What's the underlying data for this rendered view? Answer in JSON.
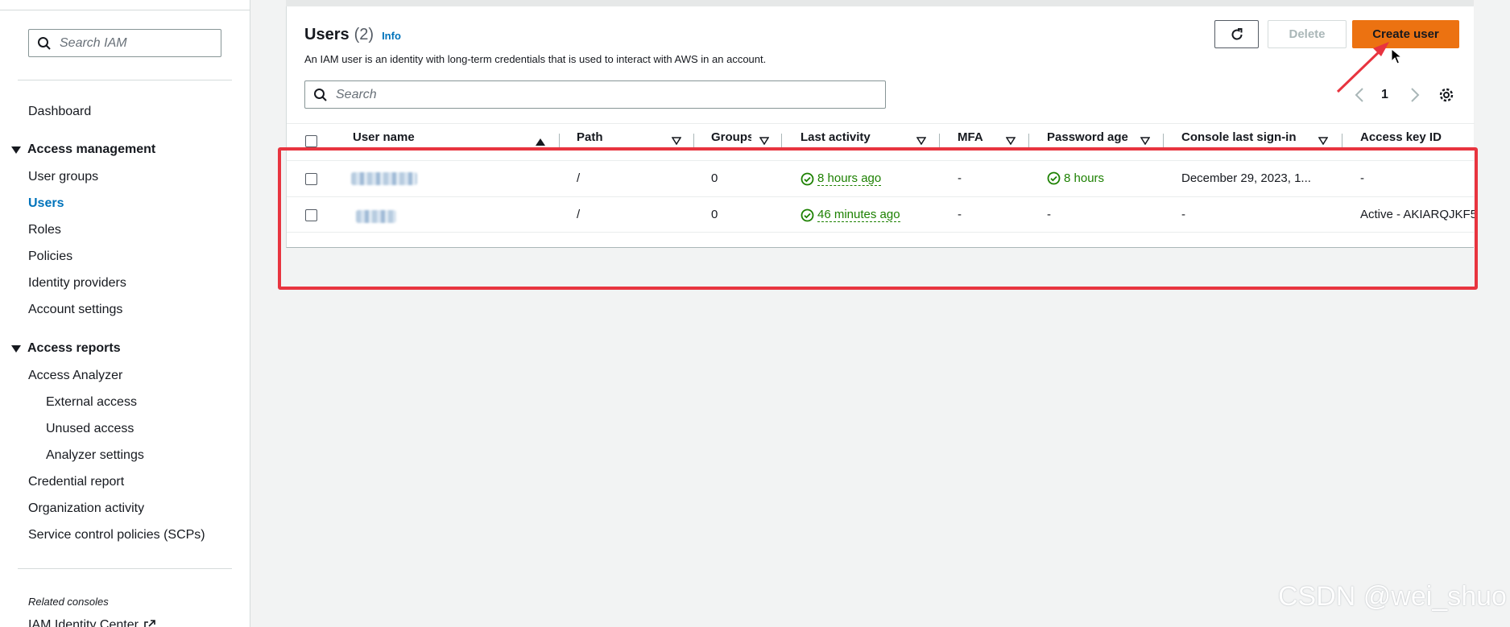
{
  "sidebar": {
    "search_placeholder": "Search IAM",
    "dashboard": "Dashboard",
    "access_management": {
      "label": "Access management",
      "items": [
        "User groups",
        "Users",
        "Roles",
        "Policies",
        "Identity providers",
        "Account settings"
      ],
      "active": "Users"
    },
    "access_reports": {
      "label": "Access reports",
      "access_analyzer": "Access Analyzer",
      "analyzer_items": [
        "External access",
        "Unused access",
        "Analyzer settings"
      ],
      "items": [
        "Credential report",
        "Organization activity",
        "Service control policies (SCPs)"
      ]
    },
    "related_consoles": "Related consoles",
    "related_item": "IAM Identity Center"
  },
  "users_panel": {
    "title": "Users",
    "count": "(2)",
    "info": "Info",
    "description": "An IAM user is an identity with long-term credentials that is used to interact with AWS in an account.",
    "refresh_icon": "refresh-icon",
    "delete_label": "Delete",
    "create_label": "Create user",
    "search_placeholder": "Search",
    "page": "1"
  },
  "table": {
    "columns": [
      "User name",
      "Path",
      "Groups",
      "Last activity",
      "MFA",
      "Password age",
      "Console last sign-in",
      "Access key ID"
    ],
    "sorted_column": "User name",
    "rows": [
      {
        "user_name": "",
        "path": "/",
        "groups": "0",
        "last_activity": "8 hours ago",
        "mfa": "-",
        "password_age": "8 hours",
        "console_last_sign_in": "December 29, 2023, 1...",
        "access_key_id": "-"
      },
      {
        "user_name": "",
        "path": "/",
        "groups": "0",
        "last_activity": "46 minutes ago",
        "mfa": "-",
        "password_age": "-",
        "console_last_sign_in": "-",
        "access_key_id": "Active - AKIARQJKF5"
      }
    ]
  },
  "colors": {
    "primary_button": "#ec7211",
    "link": "#0073bb",
    "success": "#1d8102",
    "annotation": "#e8343f"
  },
  "watermark": "CSDN @wei_shuo"
}
